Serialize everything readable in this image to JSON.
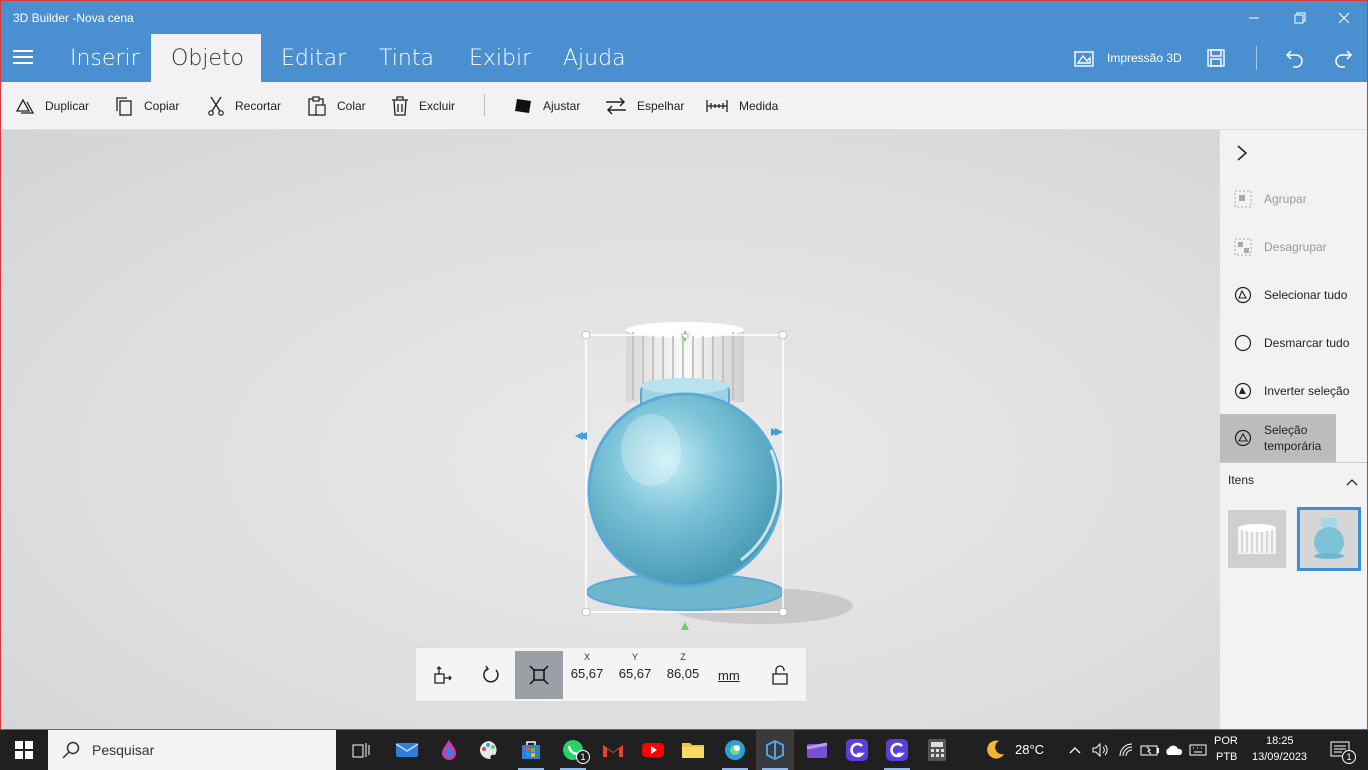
{
  "window": {
    "title": "3D Builder -Nova cena"
  },
  "menu": {
    "tabs": [
      {
        "label": "Inserir"
      },
      {
        "label": "Objeto"
      },
      {
        "label": "Editar"
      },
      {
        "label": "Tinta"
      },
      {
        "label": "Exibir"
      },
      {
        "label": "Ajuda"
      }
    ],
    "print_label": "Impressão 3D"
  },
  "toolbar": {
    "duplicate": "Duplicar",
    "copy": "Copiar",
    "cut": "Recortar",
    "paste": "Colar",
    "delete": "Excluir",
    "fit": "Ajustar",
    "mirror": "Espelhar",
    "measure": "Medida"
  },
  "panel": {
    "group": "Agrupar",
    "ungroup": "Desagrupar",
    "select_all": "Selecionar tudo",
    "deselect_all": "Desmarcar tudo",
    "invert": "Inverter seleção",
    "temp_line1": "Seleção",
    "temp_line2": "temporária",
    "items_header": "Itens"
  },
  "controls": {
    "x_label": "X",
    "x_value": "65,67",
    "y_label": "Y",
    "y_value": "65,67",
    "z_label": "Z",
    "z_value": "86,05",
    "unit": "mm"
  },
  "taskbar": {
    "search_placeholder": "Pesquisar",
    "temperature": "28°C",
    "lang1": "POR",
    "lang2": "PTB",
    "time": "18:25",
    "date": "13/09/2023",
    "whatsapp_badge": "1",
    "notif_badge": "1"
  },
  "colors": {
    "accent": "#4a8fd0",
    "object": "#7cc3d8"
  }
}
